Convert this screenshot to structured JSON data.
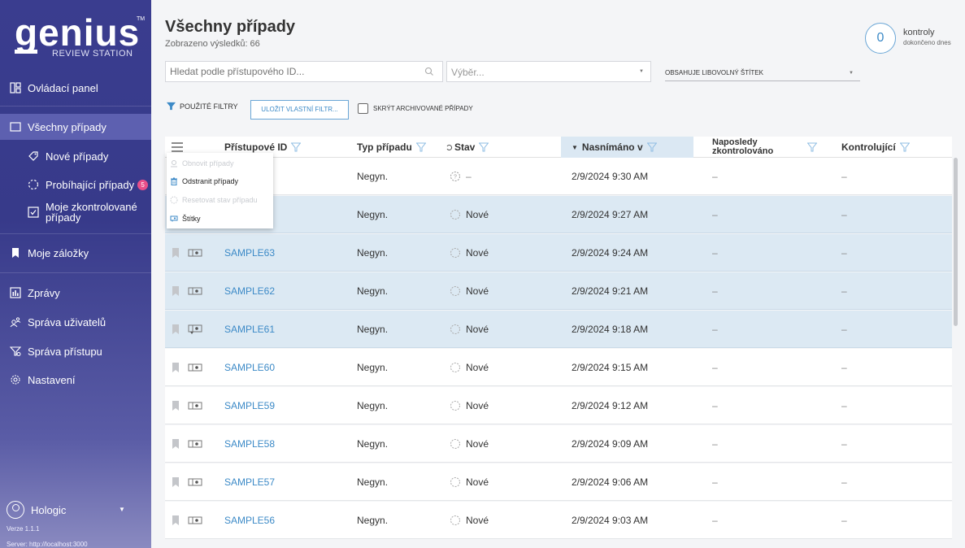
{
  "colors": {
    "brand": "#3a3d8f",
    "accent": "#3c8ac7",
    "selected_row": "#dce9f3",
    "badge": "#e94f8a"
  },
  "brand": {
    "name": "genius",
    "tm": "TM",
    "subtitle": "REVIEW STATION"
  },
  "sidebar": {
    "dashboard": "Ovládací panel",
    "all_cases": "Všechny případy",
    "new_cases": "Nové případy",
    "in_progress": "Probíhající případy",
    "in_progress_count": "5",
    "reviewed": "Moje zkontrolované případy",
    "bookmarks": "Moje záložky",
    "reports": "Zprávy",
    "user_mgmt": "Správa uživatelů",
    "access_mgmt": "Správa přístupu",
    "settings": "Nastavení"
  },
  "user": {
    "name": "Hologic",
    "version": "Verze 1.1.1",
    "server": "Server: http://localhost:3000"
  },
  "header": {
    "title": "Všechny případy",
    "results": "Zobrazeno výsledků: 66",
    "checks_count": "0",
    "checks_label": "kontroly",
    "checks_sub": "dokončeno dnes"
  },
  "filters": {
    "search_placeholder": "Hledat podle přístupového ID...",
    "select_placeholder": "Výběr...",
    "tag_filter": "OBSAHUJE LIBOVOLNÝ ŠTÍTEK",
    "applied": "POUŽITÉ FILTRY",
    "save_filter": "ULOŽIT VLASTNÍ FILTR...",
    "hide_archived": "SKRÝT ARCHIVOVANÉ PŘÍPADY"
  },
  "table": {
    "columns": {
      "access_id": "Přístupové ID",
      "case_type": "Typ případu",
      "status": "Stav",
      "captured": "Nasnímáno v",
      "last_reviewed": "Naposledy zkontrolováno",
      "reviewers": "Kontrolující"
    },
    "rows": [
      {
        "id": "",
        "type": "Negyn.",
        "status": "–",
        "captured": "2/9/2024 9:30 AM",
        "last": "–",
        "reviewer": "–"
      },
      {
        "id": "",
        "type": "Negyn.",
        "status": "Nové",
        "captured": "2/9/2024 9:27 AM",
        "last": "–",
        "reviewer": "–"
      },
      {
        "id": "SAMPLE63",
        "type": "Negyn.",
        "status": "Nové",
        "captured": "2/9/2024 9:24 AM",
        "last": "–",
        "reviewer": "–"
      },
      {
        "id": "SAMPLE62",
        "type": "Negyn.",
        "status": "Nové",
        "captured": "2/9/2024 9:21 AM",
        "last": "–",
        "reviewer": "–"
      },
      {
        "id": "SAMPLE61",
        "type": "Negyn.",
        "status": "Nové",
        "captured": "2/9/2024 9:18 AM",
        "last": "–",
        "reviewer": "–"
      },
      {
        "id": "SAMPLE60",
        "type": "Negyn.",
        "status": "Nové",
        "captured": "2/9/2024 9:15 AM",
        "last": "–",
        "reviewer": "–"
      },
      {
        "id": "SAMPLE59",
        "type": "Negyn.",
        "status": "Nové",
        "captured": "2/9/2024 9:12 AM",
        "last": "–",
        "reviewer": "–"
      },
      {
        "id": "SAMPLE58",
        "type": "Negyn.",
        "status": "Nové",
        "captured": "2/9/2024 9:09 AM",
        "last": "–",
        "reviewer": "–"
      },
      {
        "id": "SAMPLE57",
        "type": "Negyn.",
        "status": "Nové",
        "captured": "2/9/2024 9:06 AM",
        "last": "–",
        "reviewer": "–"
      },
      {
        "id": "SAMPLE56",
        "type": "Negyn.",
        "status": "Nové",
        "captured": "2/9/2024 9:03 AM",
        "last": "–",
        "reviewer": "–"
      }
    ]
  },
  "context_menu": {
    "restore": "Obnovit případy",
    "delete": "Odstranit případy",
    "reset_status": "Resetovat stav případu",
    "tags": "Štítky"
  }
}
